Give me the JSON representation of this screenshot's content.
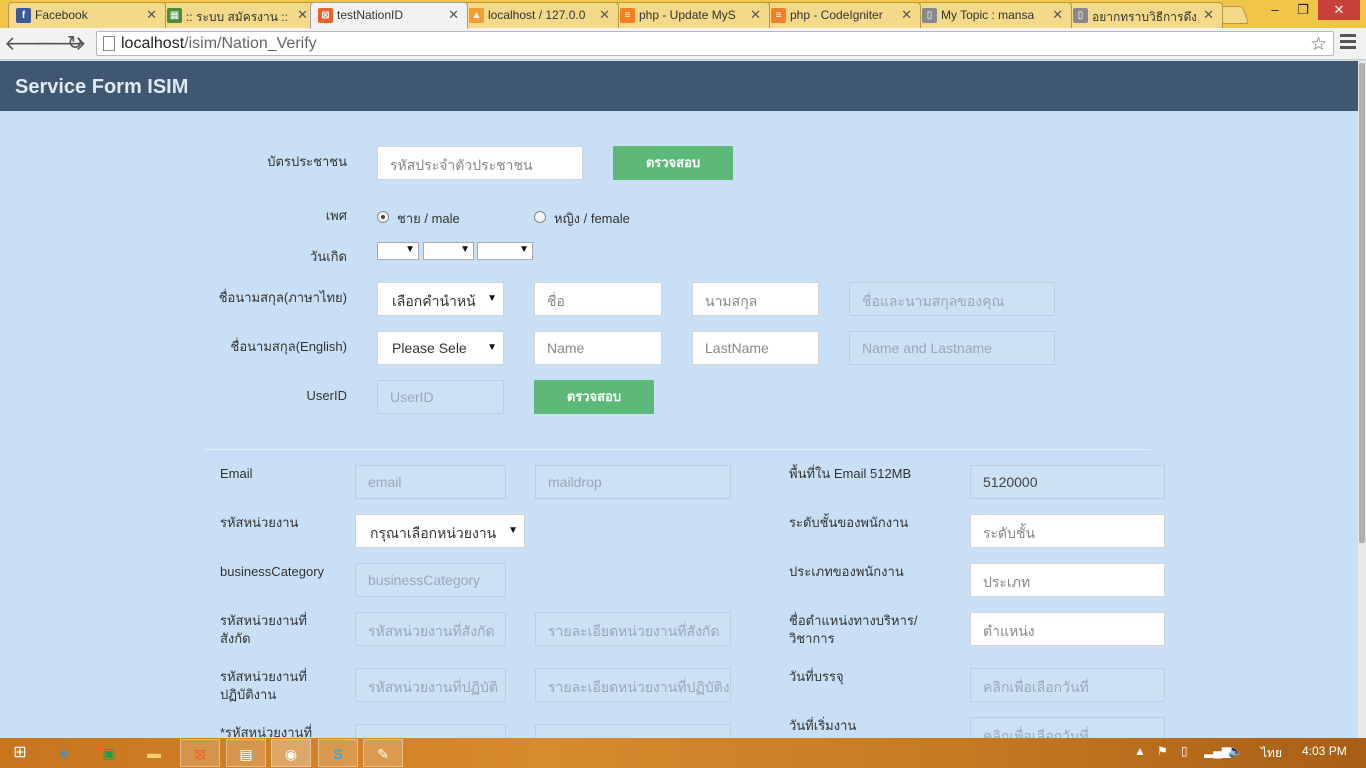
{
  "browser": {
    "tabs": [
      {
        "label": "Facebook",
        "icon": "facebook-icon",
        "color": "#3b5998",
        "glyph": "f"
      },
      {
        "label": ":: ระบบ สมัครงาน ::",
        "icon": "page-icon",
        "color": "#4b8b3b",
        "glyph": "▦"
      },
      {
        "label": "testNationID",
        "icon": "xampp-icon",
        "color": "#e8632b",
        "glyph": "⊠",
        "active": true
      },
      {
        "label": "localhost / 127.0.0",
        "icon": "phpmyadmin-icon",
        "color": "#f0a030",
        "glyph": "▲"
      },
      {
        "label": "php - Update MyS",
        "icon": "stackoverflow-icon",
        "color": "#f48024",
        "glyph": "≡"
      },
      {
        "label": "php - CodeIgniter",
        "icon": "stackoverflow-icon",
        "color": "#f48024",
        "glyph": "≡"
      },
      {
        "label": "My Topic : mansa",
        "icon": "document-icon",
        "color": "#888888",
        "glyph": "▯"
      },
      {
        "label": "อยากทราบวิธีการดึงข้",
        "icon": "document-icon",
        "color": "#888888",
        "glyph": "▯"
      }
    ],
    "url_host": "localhost",
    "url_path": "/isim/Nation_Verify"
  },
  "header": {
    "title": "Service Form ISIM"
  },
  "form": {
    "national_id_label": "บัตรประชาชน",
    "national_id_placeholder": "รหัสประจำตัวประชาชน",
    "verify_button": "ตรวจสอบ",
    "gender_label": "เพศ",
    "gender_male": "ชาย / male",
    "gender_female": "หญิง / female",
    "birthdate_label": "วันเกิด",
    "thai_name_label": "ชื่อนามสกุล(ภาษาไทย)",
    "thai_title_select": "เลือกคำนำหน้",
    "thai_first_placeholder": "ชื่อ",
    "thai_last_placeholder": "นามสกุล",
    "thai_full_placeholder": "ชื่อและนามสกุลของคุณ",
    "eng_name_label": "ชื่อนามสกุล(English)",
    "eng_title_select": "Please Sele",
    "eng_first_placeholder": "Name",
    "eng_last_placeholder": "LastName",
    "eng_full_placeholder": "Name and Lastname",
    "userid_label": "UserID",
    "userid_placeholder": "UserID",
    "userid_verify_button": "ตรวจสอบ"
  },
  "details": {
    "email_label": "Email",
    "email_placeholder": "email",
    "maildrop_placeholder": "maildrop",
    "email_quota_label": "พื้นที่ใน Email 512MB",
    "email_quota_value": "5120000",
    "unit_code_label": "รหัสหน่วยงาน",
    "unit_code_select": "กรุณาเลือกหน่วยงาน",
    "staff_level_label": "ระดับชั้นของพนักงาน",
    "staff_level_placeholder": "ระดับชั้น",
    "business_category_label": "businessCategory",
    "business_category_placeholder": "businessCategory",
    "staff_type_label": "ประเภทของพนักงาน",
    "staff_type_placeholder": "ประเภท",
    "affiliated_unit_label_1": "รหัสหน่วยงานที่",
    "affiliated_unit_label_2": "สังกัด",
    "affiliated_unit_code_placeholder": "รหัสหน่วยงานที่สังกัด",
    "affiliated_unit_detail_placeholder": "รายละเอียดหน่วยงานที่สังกัด",
    "position_label_1": "ชื่อตำแหน่งทางบริหาร/",
    "position_label_2": "วิชาการ",
    "position_placeholder": "ตำแหน่ง",
    "operating_unit_label_1": "รหัสหน่วยงานที่",
    "operating_unit_label_2": "ปฏิบัติงาน",
    "operating_unit_code_placeholder": "รหัสหน่วยงานที่ปฏิบัติ",
    "operating_unit_detail_placeholder": "รายละเอียดหน่วยงานที่ปฏิบัติง",
    "appointment_date_label": "วันที่บรรจุ",
    "appointment_date_placeholder": "คลิกเพื่อเลือกวันที่",
    "cut_unit_label": "*รหัสหน่วยงานที่",
    "start_date_label": "วันที่เริ่มงาน",
    "start_date_placeholder": "คลิกเพื่อเลือกวันที่"
  },
  "taskbar": {
    "language": "ไทย",
    "time": "4:03 PM"
  }
}
